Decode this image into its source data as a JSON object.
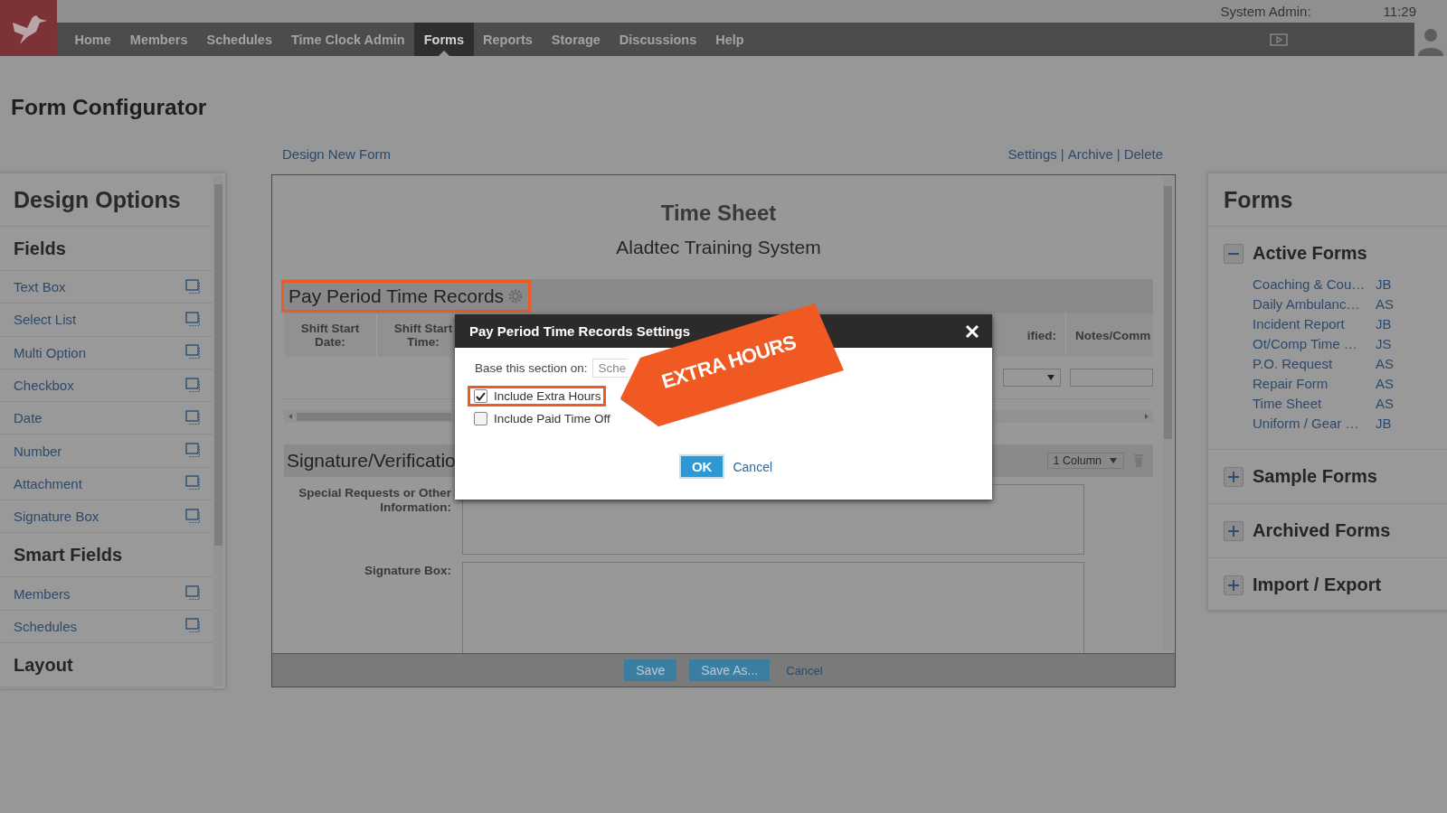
{
  "header": {
    "admin_label": "System Admin:",
    "time": "11:29"
  },
  "nav": [
    {
      "label": "Home",
      "selected": false
    },
    {
      "label": "Members",
      "selected": false
    },
    {
      "label": "Schedules",
      "selected": false
    },
    {
      "label": "Time Clock Admin",
      "selected": false
    },
    {
      "label": "Forms",
      "selected": true
    },
    {
      "label": "Reports",
      "selected": false
    },
    {
      "label": "Storage",
      "selected": false
    },
    {
      "label": "Discussions",
      "selected": false
    },
    {
      "label": "Help",
      "selected": false
    }
  ],
  "page_title": "Form Configurator",
  "toolbar": {
    "design_link": "Design New Form",
    "actions": [
      "Settings",
      "Archive",
      "Delete"
    ],
    "separator": "|"
  },
  "design_options": {
    "title": "Design Options",
    "groups": [
      {
        "heading": "Fields",
        "items": [
          "Text Box",
          "Select List",
          "Multi Option",
          "Checkbox",
          "Date",
          "Number",
          "Attachment",
          "Signature Box"
        ]
      },
      {
        "heading": "Smart Fields",
        "items": [
          "Members",
          "Schedules"
        ]
      },
      {
        "heading": "Layout"
      }
    ]
  },
  "form": {
    "title": "Time Sheet",
    "subtitle": "Aladtec Training System",
    "time_records": {
      "heading": "Pay Period Time Records",
      "highlighted": true,
      "columns_left": [
        "Shift Start Date:",
        "Shift Start Time:"
      ],
      "columns_right": [
        "ified:",
        "Notes/Comm"
      ]
    },
    "signature": {
      "heading": "Signature/Verificatio",
      "layout": "1 Column",
      "fields": [
        {
          "label": "Special Requests or Other\nInformation:",
          "kind": "textarea"
        },
        {
          "label": "Signature Box:",
          "kind": "signature"
        }
      ]
    },
    "actions": [
      {
        "label": "Save",
        "kind": "button"
      },
      {
        "label": "Save As...",
        "kind": "button"
      },
      {
        "label": "Cancel",
        "kind": "link"
      }
    ]
  },
  "forms_panel": {
    "title": "Forms",
    "groups": [
      {
        "heading": "Active Forms",
        "expanded": true,
        "items": [
          {
            "name": "Coaching & Cou…",
            "owner": "JB"
          },
          {
            "name": "Daily Ambulanc…",
            "owner": "AS"
          },
          {
            "name": "Incident Report",
            "owner": "JB"
          },
          {
            "name": "Ot/Comp Time …",
            "owner": "JS"
          },
          {
            "name": "P.O. Request",
            "owner": "AS"
          },
          {
            "name": "Repair Form",
            "owner": "AS"
          },
          {
            "name": "Time Sheet",
            "owner": "AS"
          },
          {
            "name": "Uniform / Gear …",
            "owner": "JB"
          }
        ]
      },
      {
        "heading": "Sample Forms",
        "expanded": false
      },
      {
        "heading": "Archived Forms",
        "expanded": false
      },
      {
        "heading": "Import / Export",
        "expanded": false
      }
    ]
  },
  "dialog": {
    "title": "Pay Period Time Records Settings",
    "base_label": "Base this section on:",
    "base_value": "Sche",
    "options": [
      {
        "label": "Include Extra Hours",
        "checked": true,
        "highlighted": true
      },
      {
        "label": "Include Paid Time Off",
        "checked": false,
        "highlighted": false
      }
    ],
    "buttons": [
      {
        "label": "OK",
        "kind": "primary"
      },
      {
        "label": "Cancel",
        "kind": "link"
      }
    ]
  },
  "callout": {
    "text": "EXTRA HOURS"
  }
}
